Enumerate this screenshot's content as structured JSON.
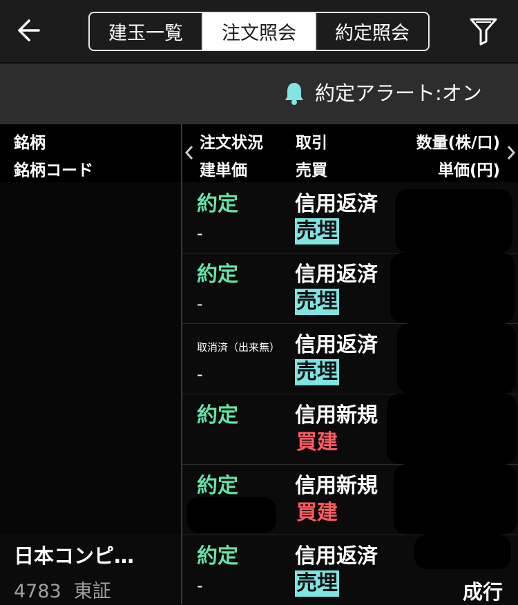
{
  "header": {
    "back_icon": "back-arrow-icon",
    "filter_icon": "filter-icon",
    "tabs": [
      {
        "label": "建玉一覧",
        "active": false
      },
      {
        "label": "注文照会",
        "active": true
      },
      {
        "label": "約定照会",
        "active": false
      }
    ]
  },
  "alert": {
    "icon": "bell-icon",
    "label": "約定アラート:オン"
  },
  "columns": {
    "name": "銘柄",
    "code": "銘柄コード",
    "status": "注文状況",
    "open_price": "建単価",
    "trade": "取引",
    "side": "売買",
    "qty": "数量(株/口)",
    "unit_price": "単価(円)"
  },
  "colors": {
    "filled": "#66e3a6",
    "sell_bg": "#7fe4e2",
    "buy": "#ff5a61"
  },
  "rows": [
    {
      "status": "約定",
      "trade": "信用返済",
      "price": "-",
      "side": "売埋",
      "side_type": "sell"
    },
    {
      "status": "約定",
      "trade": "信用返済",
      "price": "-",
      "side": "売埋",
      "side_type": "sell"
    },
    {
      "status": "取消済（出来無）",
      "trade": "信用返済",
      "price": "-",
      "side": "売埋",
      "side_type": "sell"
    },
    {
      "status": "約定",
      "trade": "信用新規",
      "price": "",
      "side": "買建",
      "side_type": "buy"
    },
    {
      "status": "約定",
      "trade": "信用新規",
      "price": "",
      "side": "買建",
      "side_type": "buy"
    },
    {
      "status": "約定",
      "trade": "信用返済",
      "price": "-",
      "side": "売埋",
      "side_type": "sell",
      "name": "日本コンピ…",
      "code": "4783",
      "market": "東証",
      "order_type": "成行"
    }
  ]
}
